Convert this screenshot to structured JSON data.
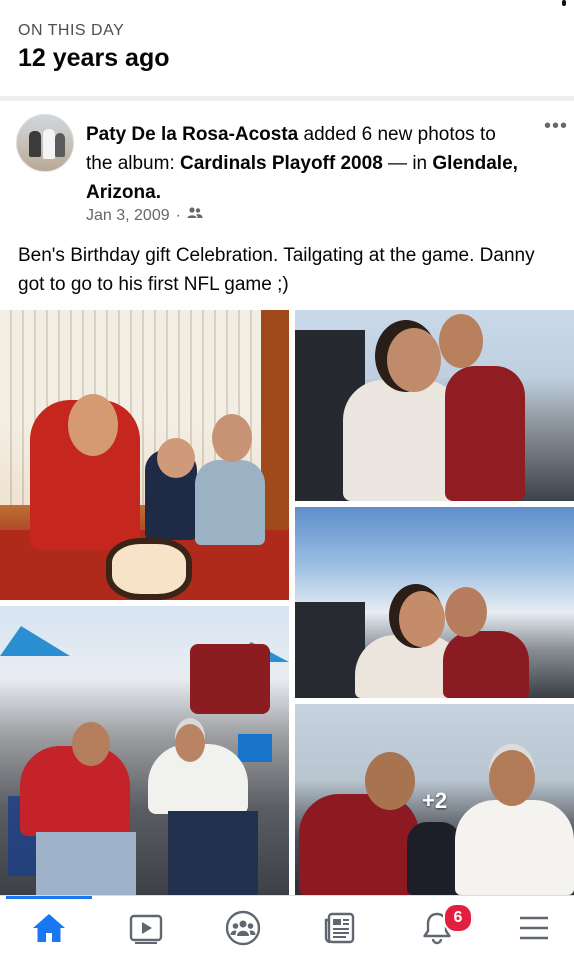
{
  "memory": {
    "label": "ON THIS DAY",
    "years_ago": "12 years ago"
  },
  "post": {
    "author": "Paty De la Rosa-Acosta",
    "action_text": " added 6 new photos to the album: ",
    "album": "Cardinals Playoff 2008",
    "in_text": " — in ",
    "location": "Glendale, Arizona",
    "location_suffix": ".",
    "date": "Jan 3, 2009",
    "dot": "·",
    "audience_icon": "friends-icon",
    "more_label": "•••",
    "text": "Ben's Birthday gift Celebration. Tailgating at the game. Danny got to go to his first NFL game ;)",
    "more_photos": "+2"
  },
  "tabbar": {
    "items": [
      {
        "icon": "home-icon",
        "active": true
      },
      {
        "icon": "video-icon",
        "active": false
      },
      {
        "icon": "groups-icon",
        "active": false
      },
      {
        "icon": "news-icon",
        "active": false
      },
      {
        "icon": "bell-icon",
        "active": false
      },
      {
        "icon": "menu-icon",
        "active": false
      }
    ],
    "notification_count": "6"
  },
  "colors": {
    "accent": "#1877f2",
    "badge": "#e41e3f",
    "secondary_text": "#65676b"
  }
}
